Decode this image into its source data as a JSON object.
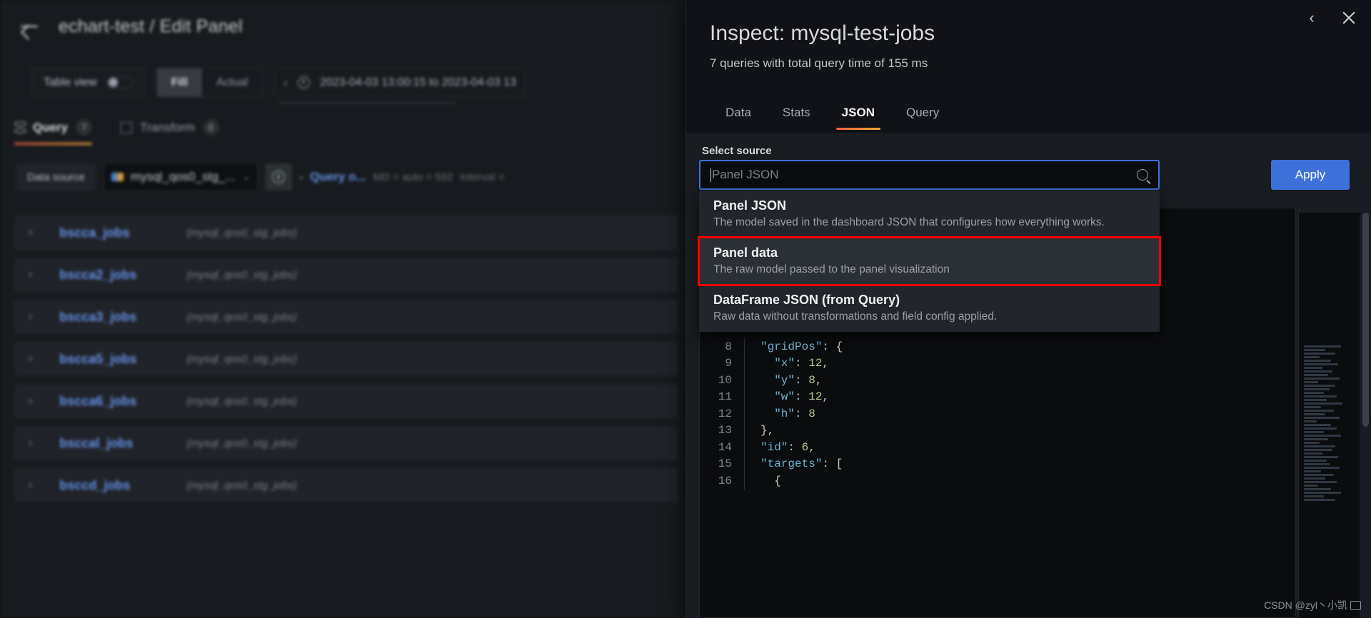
{
  "editPanel": {
    "back_icon": "arrow-left-icon",
    "title": "echart-test / Edit Panel",
    "toolbar": {
      "table_view_label": "Table view",
      "fill_label": "Fill",
      "actual_label": "Actual",
      "prev_range_icon": "chevron-left-icon",
      "clock_icon": "clock-icon",
      "time_range": "2023-04-03 13:00:15 to 2023-04-03 13"
    },
    "tabs": [
      {
        "label": "Query",
        "count": "7",
        "icon": "database-icon",
        "active": true
      },
      {
        "label": "Transform",
        "count": "0",
        "icon": "transform-icon",
        "active": false
      }
    ],
    "datasource": {
      "label": "Data source",
      "selected": "mysql_qos0_stg_...",
      "caret_icon": "chevron-down-icon",
      "help_icon": "help-circle-icon",
      "query_options_label": "Query o...",
      "expand_icon": "chevron-right-icon",
      "md_text": "MD = auto = 592",
      "interval_text": "Interval ="
    },
    "queries": [
      {
        "name": "bscca_jobs",
        "source": "(mysql_qos0_stg_jobs)"
      },
      {
        "name": "bscca2_jobs",
        "source": "(mysql_qos0_stg_jobs)"
      },
      {
        "name": "bscca3_jobs",
        "source": "(mysql_qos0_stg_jobs)"
      },
      {
        "name": "bscca5_jobs",
        "source": "(mysql_qos0_stg_jobs)"
      },
      {
        "name": "bscca6_jobs",
        "source": "(mysql_qos0_stg_jobs)"
      },
      {
        "name": "bsccal_jobs",
        "source": "(mysql_qos0_stg_jobs)"
      },
      {
        "name": "bsccd_jobs",
        "source": "(mysql_qos0_stg_jobs)"
      }
    ]
  },
  "inspector": {
    "collapse_icon": "chevron-left-icon",
    "close_icon": "close-icon",
    "title": "Inspect: mysql-test-jobs",
    "subtitle": "7 queries with total query time of 155 ms",
    "tabs": [
      {
        "label": "Data",
        "active": false
      },
      {
        "label": "Stats",
        "active": false
      },
      {
        "label": "JSON",
        "active": true
      },
      {
        "label": "Query",
        "active": false
      }
    ],
    "select_source": {
      "label": "Select source",
      "value": "",
      "placeholder": "Panel JSON",
      "search_icon": "search-icon"
    },
    "apply_label": "Apply",
    "options": [
      {
        "title": "Panel JSON",
        "description": "The model saved in the dashboard JSON that configures how everything works.",
        "highlighted": false,
        "boxed": false
      },
      {
        "title": "Panel data",
        "description": "The raw model passed to the panel visualization",
        "highlighted": true,
        "boxed": true
      },
      {
        "title": "DataFrame JSON (from Query)",
        "description": "Raw data without transformations and field config applied.",
        "highlighted": false,
        "boxed": false
      }
    ],
    "code": [
      {
        "line": "8",
        "text": "\"gridPos\": {",
        "type": "key-open"
      },
      {
        "line": "9",
        "text": "  \"x\": 12,",
        "type": "kv"
      },
      {
        "line": "10",
        "text": "  \"y\": 8,",
        "type": "kv"
      },
      {
        "line": "11",
        "text": "  \"w\": 12,",
        "type": "kv"
      },
      {
        "line": "12",
        "text": "  \"h\": 8",
        "type": "kv"
      },
      {
        "line": "13",
        "text": "},",
        "type": "punct"
      },
      {
        "line": "14",
        "text": "\"id\": 6,",
        "type": "kv"
      },
      {
        "line": "15",
        "text": "\"targets\": [",
        "type": "key-open"
      },
      {
        "line": "16",
        "text": "  {",
        "type": "punct"
      }
    ]
  },
  "watermark": {
    "text": "CSDN @zyl丶小凯",
    "icon": "csdn-icon"
  },
  "colors": {
    "accent_orange": "#f55f3e",
    "accent_blue": "#3d71d9",
    "highlight_red": "#ff0000",
    "link_blue": "#6e9fff",
    "panel_bg": "#181b1f",
    "drawer_bg": "#111217"
  }
}
